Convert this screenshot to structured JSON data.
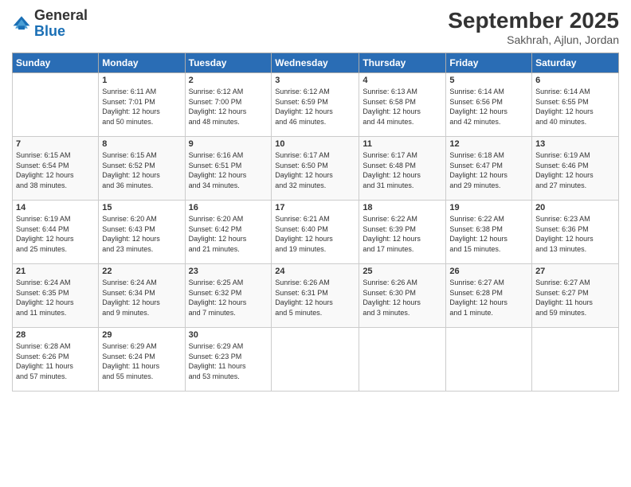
{
  "logo": {
    "general": "General",
    "blue": "Blue"
  },
  "header": {
    "month": "September 2025",
    "location": "Sakhrah, Ajlun, Jordan"
  },
  "weekdays": [
    "Sunday",
    "Monday",
    "Tuesday",
    "Wednesday",
    "Thursday",
    "Friday",
    "Saturday"
  ],
  "weeks": [
    [
      {
        "day": "",
        "info": ""
      },
      {
        "day": "1",
        "info": "Sunrise: 6:11 AM\nSunset: 7:01 PM\nDaylight: 12 hours\nand 50 minutes."
      },
      {
        "day": "2",
        "info": "Sunrise: 6:12 AM\nSunset: 7:00 PM\nDaylight: 12 hours\nand 48 minutes."
      },
      {
        "day": "3",
        "info": "Sunrise: 6:12 AM\nSunset: 6:59 PM\nDaylight: 12 hours\nand 46 minutes."
      },
      {
        "day": "4",
        "info": "Sunrise: 6:13 AM\nSunset: 6:58 PM\nDaylight: 12 hours\nand 44 minutes."
      },
      {
        "day": "5",
        "info": "Sunrise: 6:14 AM\nSunset: 6:56 PM\nDaylight: 12 hours\nand 42 minutes."
      },
      {
        "day": "6",
        "info": "Sunrise: 6:14 AM\nSunset: 6:55 PM\nDaylight: 12 hours\nand 40 minutes."
      }
    ],
    [
      {
        "day": "7",
        "info": "Sunrise: 6:15 AM\nSunset: 6:54 PM\nDaylight: 12 hours\nand 38 minutes."
      },
      {
        "day": "8",
        "info": "Sunrise: 6:15 AM\nSunset: 6:52 PM\nDaylight: 12 hours\nand 36 minutes."
      },
      {
        "day": "9",
        "info": "Sunrise: 6:16 AM\nSunset: 6:51 PM\nDaylight: 12 hours\nand 34 minutes."
      },
      {
        "day": "10",
        "info": "Sunrise: 6:17 AM\nSunset: 6:50 PM\nDaylight: 12 hours\nand 32 minutes."
      },
      {
        "day": "11",
        "info": "Sunrise: 6:17 AM\nSunset: 6:48 PM\nDaylight: 12 hours\nand 31 minutes."
      },
      {
        "day": "12",
        "info": "Sunrise: 6:18 AM\nSunset: 6:47 PM\nDaylight: 12 hours\nand 29 minutes."
      },
      {
        "day": "13",
        "info": "Sunrise: 6:19 AM\nSunset: 6:46 PM\nDaylight: 12 hours\nand 27 minutes."
      }
    ],
    [
      {
        "day": "14",
        "info": "Sunrise: 6:19 AM\nSunset: 6:44 PM\nDaylight: 12 hours\nand 25 minutes."
      },
      {
        "day": "15",
        "info": "Sunrise: 6:20 AM\nSunset: 6:43 PM\nDaylight: 12 hours\nand 23 minutes."
      },
      {
        "day": "16",
        "info": "Sunrise: 6:20 AM\nSunset: 6:42 PM\nDaylight: 12 hours\nand 21 minutes."
      },
      {
        "day": "17",
        "info": "Sunrise: 6:21 AM\nSunset: 6:40 PM\nDaylight: 12 hours\nand 19 minutes."
      },
      {
        "day": "18",
        "info": "Sunrise: 6:22 AM\nSunset: 6:39 PM\nDaylight: 12 hours\nand 17 minutes."
      },
      {
        "day": "19",
        "info": "Sunrise: 6:22 AM\nSunset: 6:38 PM\nDaylight: 12 hours\nand 15 minutes."
      },
      {
        "day": "20",
        "info": "Sunrise: 6:23 AM\nSunset: 6:36 PM\nDaylight: 12 hours\nand 13 minutes."
      }
    ],
    [
      {
        "day": "21",
        "info": "Sunrise: 6:24 AM\nSunset: 6:35 PM\nDaylight: 12 hours\nand 11 minutes."
      },
      {
        "day": "22",
        "info": "Sunrise: 6:24 AM\nSunset: 6:34 PM\nDaylight: 12 hours\nand 9 minutes."
      },
      {
        "day": "23",
        "info": "Sunrise: 6:25 AM\nSunset: 6:32 PM\nDaylight: 12 hours\nand 7 minutes."
      },
      {
        "day": "24",
        "info": "Sunrise: 6:26 AM\nSunset: 6:31 PM\nDaylight: 12 hours\nand 5 minutes."
      },
      {
        "day": "25",
        "info": "Sunrise: 6:26 AM\nSunset: 6:30 PM\nDaylight: 12 hours\nand 3 minutes."
      },
      {
        "day": "26",
        "info": "Sunrise: 6:27 AM\nSunset: 6:28 PM\nDaylight: 12 hours\nand 1 minute."
      },
      {
        "day": "27",
        "info": "Sunrise: 6:27 AM\nSunset: 6:27 PM\nDaylight: 11 hours\nand 59 minutes."
      }
    ],
    [
      {
        "day": "28",
        "info": "Sunrise: 6:28 AM\nSunset: 6:26 PM\nDaylight: 11 hours\nand 57 minutes."
      },
      {
        "day": "29",
        "info": "Sunrise: 6:29 AM\nSunset: 6:24 PM\nDaylight: 11 hours\nand 55 minutes."
      },
      {
        "day": "30",
        "info": "Sunrise: 6:29 AM\nSunset: 6:23 PM\nDaylight: 11 hours\nand 53 minutes."
      },
      {
        "day": "",
        "info": ""
      },
      {
        "day": "",
        "info": ""
      },
      {
        "day": "",
        "info": ""
      },
      {
        "day": "",
        "info": ""
      }
    ]
  ]
}
